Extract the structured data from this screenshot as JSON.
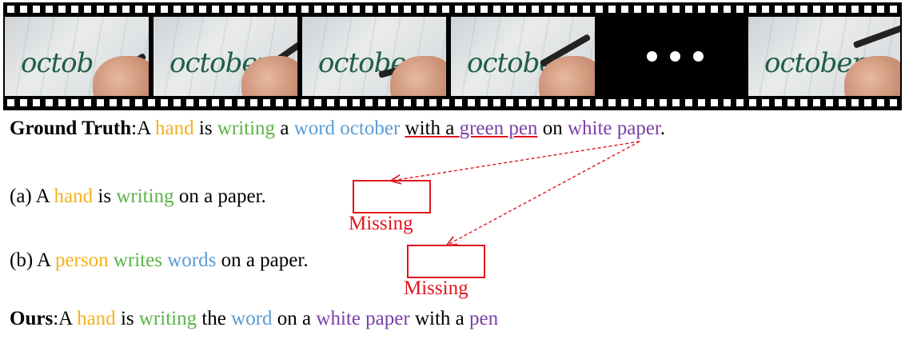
{
  "filmstrip": {
    "frames": [
      {
        "word": "octob"
      },
      {
        "word": "october"
      },
      {
        "word": "octobe"
      },
      {
        "word": "octobe"
      },
      {
        "ellipsis": true
      },
      {
        "word": "october"
      }
    ]
  },
  "ground_truth": {
    "label": "Ground Truth",
    "sep": ":",
    "tokens": [
      {
        "text": "A ",
        "color": "black"
      },
      {
        "text": "hand",
        "color": "orange"
      },
      {
        "text": " is ",
        "color": "black"
      },
      {
        "text": "writing",
        "color": "green"
      },
      {
        "text": " a ",
        "color": "black"
      },
      {
        "text": "word october",
        "color": "blue"
      },
      {
        "text": " ",
        "color": "black"
      },
      {
        "text": "with a ",
        "color": "black",
        "underline": true
      },
      {
        "text": "green pen",
        "color": "purple",
        "underline": true
      },
      {
        "text": " on ",
        "color": "black"
      },
      {
        "text": "white paper",
        "color": "purple"
      },
      {
        "text": ".",
        "color": "black"
      }
    ]
  },
  "caption_a": {
    "tokens": [
      {
        "text": "(a) A ",
        "color": "black"
      },
      {
        "text": "hand",
        "color": "orange"
      },
      {
        "text": " is ",
        "color": "black"
      },
      {
        "text": "writing",
        "color": "green"
      },
      {
        "text": " on a paper.",
        "color": "black"
      }
    ],
    "missing_label": "Missing"
  },
  "caption_b": {
    "tokens": [
      {
        "text": "(b) A ",
        "color": "black"
      },
      {
        "text": "person",
        "color": "orange"
      },
      {
        "text": " ",
        "color": "black"
      },
      {
        "text": "writes",
        "color": "green"
      },
      {
        "text": " ",
        "color": "black"
      },
      {
        "text": "words",
        "color": "blue"
      },
      {
        "text": " on a paper.",
        "color": "black"
      }
    ],
    "missing_label": "Missing"
  },
  "ours": {
    "label": "Ours",
    "sep": ":",
    "tokens": [
      {
        "text": "A ",
        "color": "black"
      },
      {
        "text": "hand",
        "color": "orange"
      },
      {
        "text": " is ",
        "color": "black"
      },
      {
        "text": "writing",
        "color": "green"
      },
      {
        "text": " the ",
        "color": "black"
      },
      {
        "text": "word",
        "color": "blue"
      },
      {
        "text": " on a ",
        "color": "black"
      },
      {
        "text": "white paper",
        "color": "purple"
      },
      {
        "text": " with a ",
        "color": "black"
      },
      {
        "text": "pen",
        "color": "purple"
      }
    ]
  },
  "colors": {
    "orange": "#f4b21c",
    "green": "#5cb346",
    "blue": "#5b9bd5",
    "purple": "#7b3fa6",
    "annotation_red": "#e0141e"
  }
}
